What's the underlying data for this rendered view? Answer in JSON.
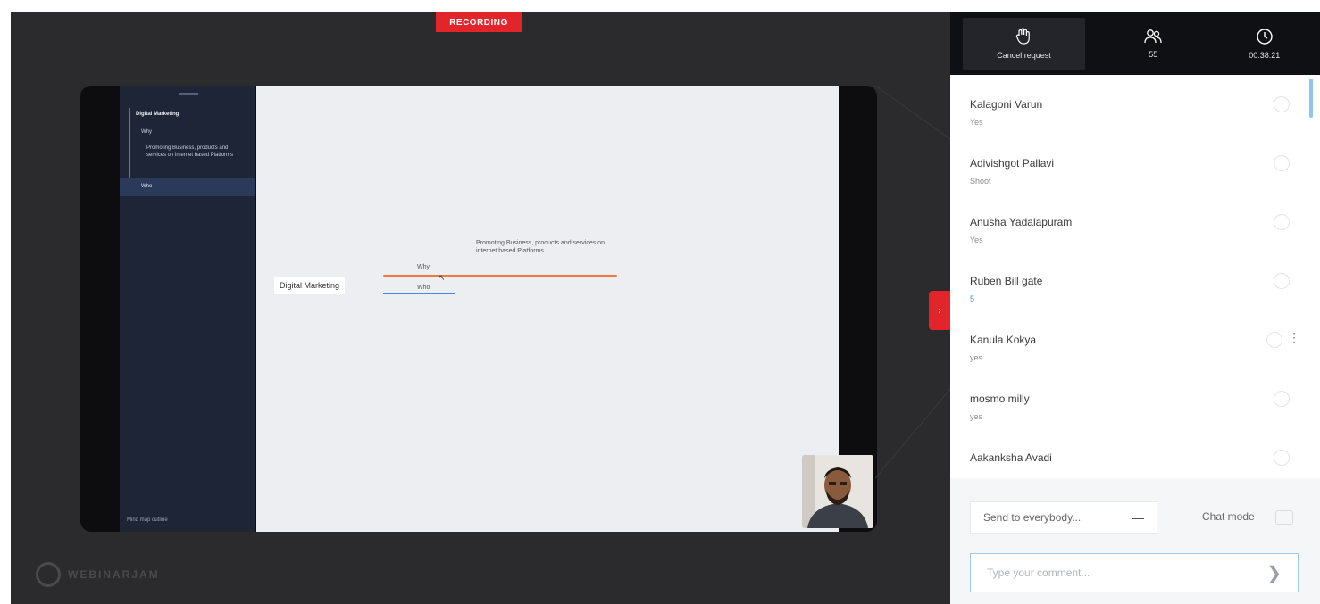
{
  "recording_badge": "RECORDING",
  "slide_sidebar": {
    "title": "Digital Marketing",
    "why": "Why",
    "description": "Promoting Business, products and services on internet based Platforms",
    "selected": "Who",
    "footer": "Mind map outline"
  },
  "mindmap": {
    "root": "Digital Marketing",
    "why": "Why",
    "who": "Who",
    "description": "Promoting Business, products and services on internet based Platforms..."
  },
  "watermark": "WEBINARJAM",
  "side_tab_label": "›",
  "top_bar": {
    "raise_hand": {
      "icon": "hand-icon",
      "label": "Cancel request"
    },
    "participants": {
      "icon": "people-icon",
      "label": "55"
    },
    "timer": {
      "icon": "clock-icon",
      "label": "00:38:21"
    }
  },
  "participants": [
    {
      "name": "Kalagoni Varun",
      "message": "Yes"
    },
    {
      "name": "Adivishgot Pallavi",
      "message": "Shoot"
    },
    {
      "name": "Anusha Yadalapuram",
      "message": "Yes"
    },
    {
      "name": "Ruben Bill gate",
      "message": "5"
    },
    {
      "name": "Kanula Kokya",
      "message": "yes"
    },
    {
      "name": "mosmo milly",
      "message": "yes"
    },
    {
      "name": "Aakanksha Avadi",
      "message": ""
    }
  ],
  "chat": {
    "send_to": "Send to everybody...",
    "chat_mode": "Chat mode",
    "input_placeholder": "Type your comment..."
  }
}
